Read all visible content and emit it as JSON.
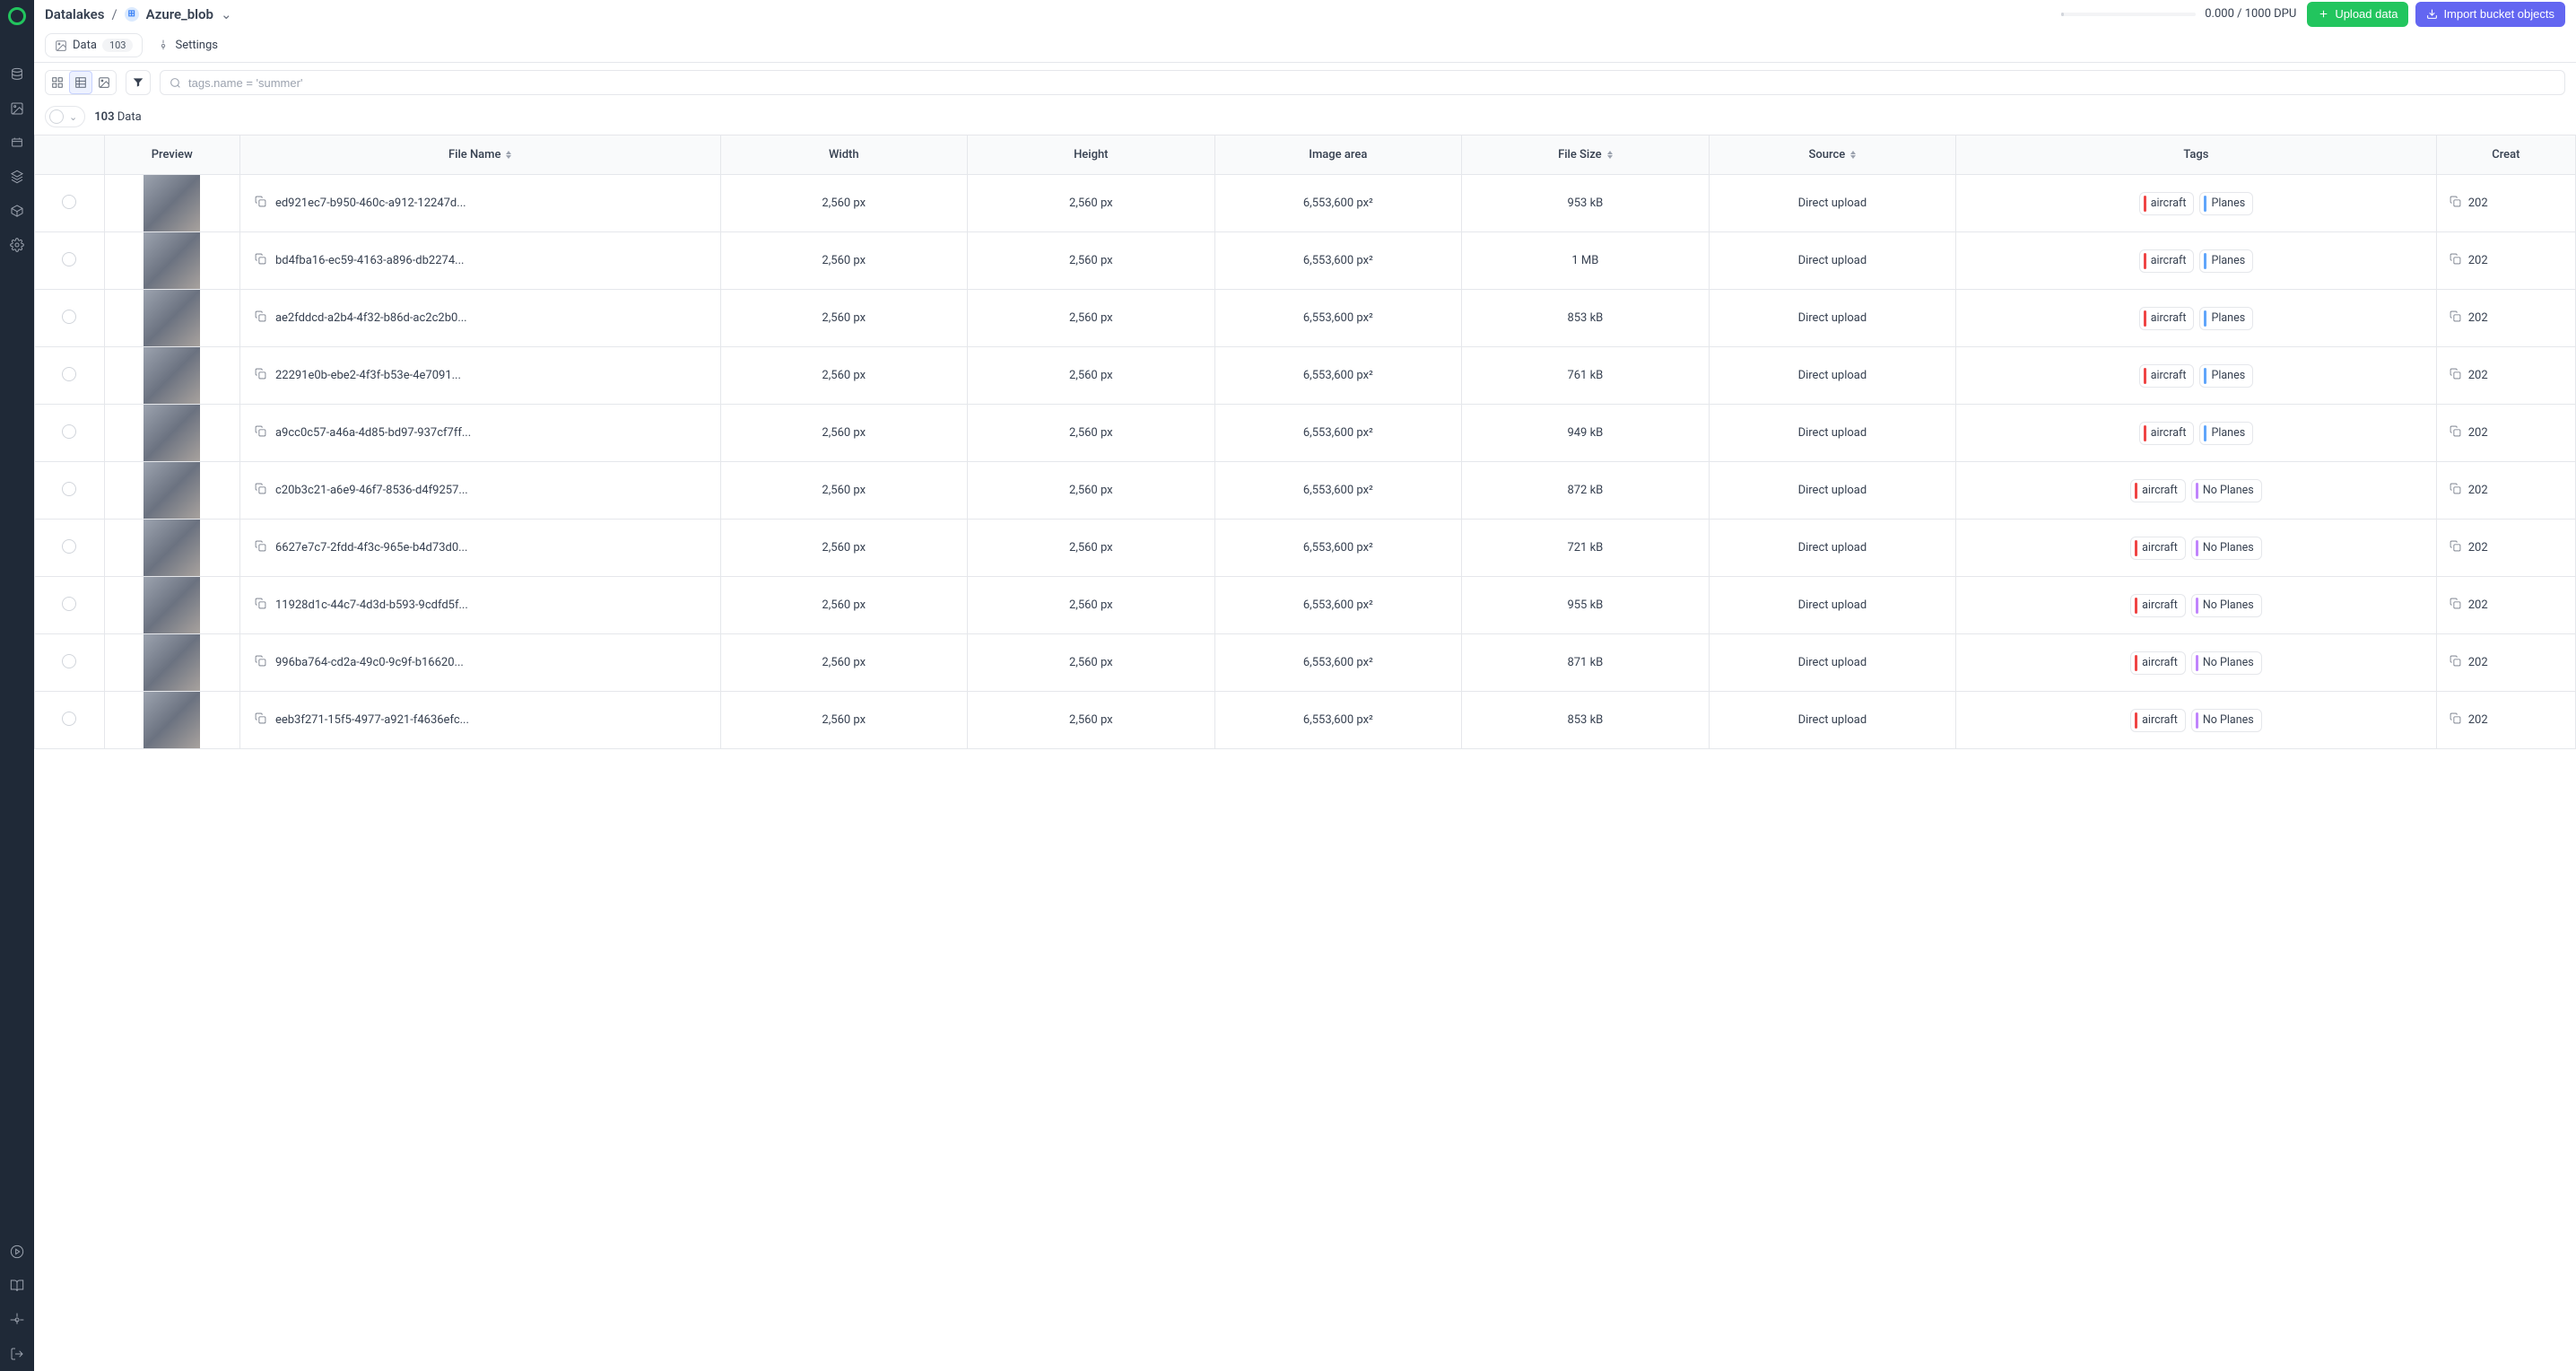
{
  "breadcrumb": {
    "root": "Datalakes",
    "current": "Azure_blob"
  },
  "header": {
    "dpu": "0.000 / 1000 DPU",
    "upload_label": "Upload data",
    "import_label": "Import bucket objects"
  },
  "tabs": {
    "data_label": "Data",
    "data_count": "103",
    "settings_label": "Settings"
  },
  "search": {
    "placeholder": "tags.name = 'summer'"
  },
  "selection": {
    "count": "103",
    "label": "Data"
  },
  "columns": {
    "preview": "Preview",
    "filename": "File Name",
    "width": "Width",
    "height": "Height",
    "area": "Image area",
    "size": "File Size",
    "source": "Source",
    "tags": "Tags",
    "created": "Creat"
  },
  "rows": [
    {
      "filename": "ed921ec7-b950-460c-a912-12247d...",
      "width": "2,560 px",
      "height": "2,560 px",
      "area": "6,553,600 px²",
      "size": "953 kB",
      "source": "Direct upload",
      "tags": [
        {
          "c": "red",
          "t": "aircraft"
        },
        {
          "c": "blue",
          "t": "Planes"
        }
      ],
      "created": "202"
    },
    {
      "filename": "bd4fba16-ec59-4163-a896-db2274...",
      "width": "2,560 px",
      "height": "2,560 px",
      "area": "6,553,600 px²",
      "size": "1 MB",
      "source": "Direct upload",
      "tags": [
        {
          "c": "red",
          "t": "aircraft"
        },
        {
          "c": "blue",
          "t": "Planes"
        }
      ],
      "created": "202"
    },
    {
      "filename": "ae2fddcd-a2b4-4f32-b86d-ac2c2b0...",
      "width": "2,560 px",
      "height": "2,560 px",
      "area": "6,553,600 px²",
      "size": "853 kB",
      "source": "Direct upload",
      "tags": [
        {
          "c": "red",
          "t": "aircraft"
        },
        {
          "c": "blue",
          "t": "Planes"
        }
      ],
      "created": "202"
    },
    {
      "filename": "22291e0b-ebe2-4f3f-b53e-4e7091...",
      "width": "2,560 px",
      "height": "2,560 px",
      "area": "6,553,600 px²",
      "size": "761 kB",
      "source": "Direct upload",
      "tags": [
        {
          "c": "red",
          "t": "aircraft"
        },
        {
          "c": "blue",
          "t": "Planes"
        }
      ],
      "created": "202"
    },
    {
      "filename": "a9cc0c57-a46a-4d85-bd97-937cf7ff...",
      "width": "2,560 px",
      "height": "2,560 px",
      "area": "6,553,600 px²",
      "size": "949 kB",
      "source": "Direct upload",
      "tags": [
        {
          "c": "red",
          "t": "aircraft"
        },
        {
          "c": "blue",
          "t": "Planes"
        }
      ],
      "created": "202"
    },
    {
      "filename": "c20b3c21-a6e9-46f7-8536-d4f9257...",
      "width": "2,560 px",
      "height": "2,560 px",
      "area": "6,553,600 px²",
      "size": "872 kB",
      "source": "Direct upload",
      "tags": [
        {
          "c": "red",
          "t": "aircraft"
        },
        {
          "c": "purple",
          "t": "No Planes"
        }
      ],
      "created": "202"
    },
    {
      "filename": "6627e7c7-2fdd-4f3c-965e-b4d73d0...",
      "width": "2,560 px",
      "height": "2,560 px",
      "area": "6,553,600 px²",
      "size": "721 kB",
      "source": "Direct upload",
      "tags": [
        {
          "c": "red",
          "t": "aircraft"
        },
        {
          "c": "purple",
          "t": "No Planes"
        }
      ],
      "created": "202"
    },
    {
      "filename": "11928d1c-44c7-4d3d-b593-9cdfd5f...",
      "width": "2,560 px",
      "height": "2,560 px",
      "area": "6,553,600 px²",
      "size": "955 kB",
      "source": "Direct upload",
      "tags": [
        {
          "c": "red",
          "t": "aircraft"
        },
        {
          "c": "purple",
          "t": "No Planes"
        }
      ],
      "created": "202"
    },
    {
      "filename": "996ba764-cd2a-49c0-9c9f-b16620...",
      "width": "2,560 px",
      "height": "2,560 px",
      "area": "6,553,600 px²",
      "size": "871 kB",
      "source": "Direct upload",
      "tags": [
        {
          "c": "red",
          "t": "aircraft"
        },
        {
          "c": "purple",
          "t": "No Planes"
        }
      ],
      "created": "202"
    },
    {
      "filename": "eeb3f271-15f5-4977-a921-f4636efc...",
      "width": "2,560 px",
      "height": "2,560 px",
      "area": "6,553,600 px²",
      "size": "853 kB",
      "source": "Direct upload",
      "tags": [
        {
          "c": "red",
          "t": "aircraft"
        },
        {
          "c": "purple",
          "t": "No Planes"
        }
      ],
      "created": "202"
    }
  ]
}
